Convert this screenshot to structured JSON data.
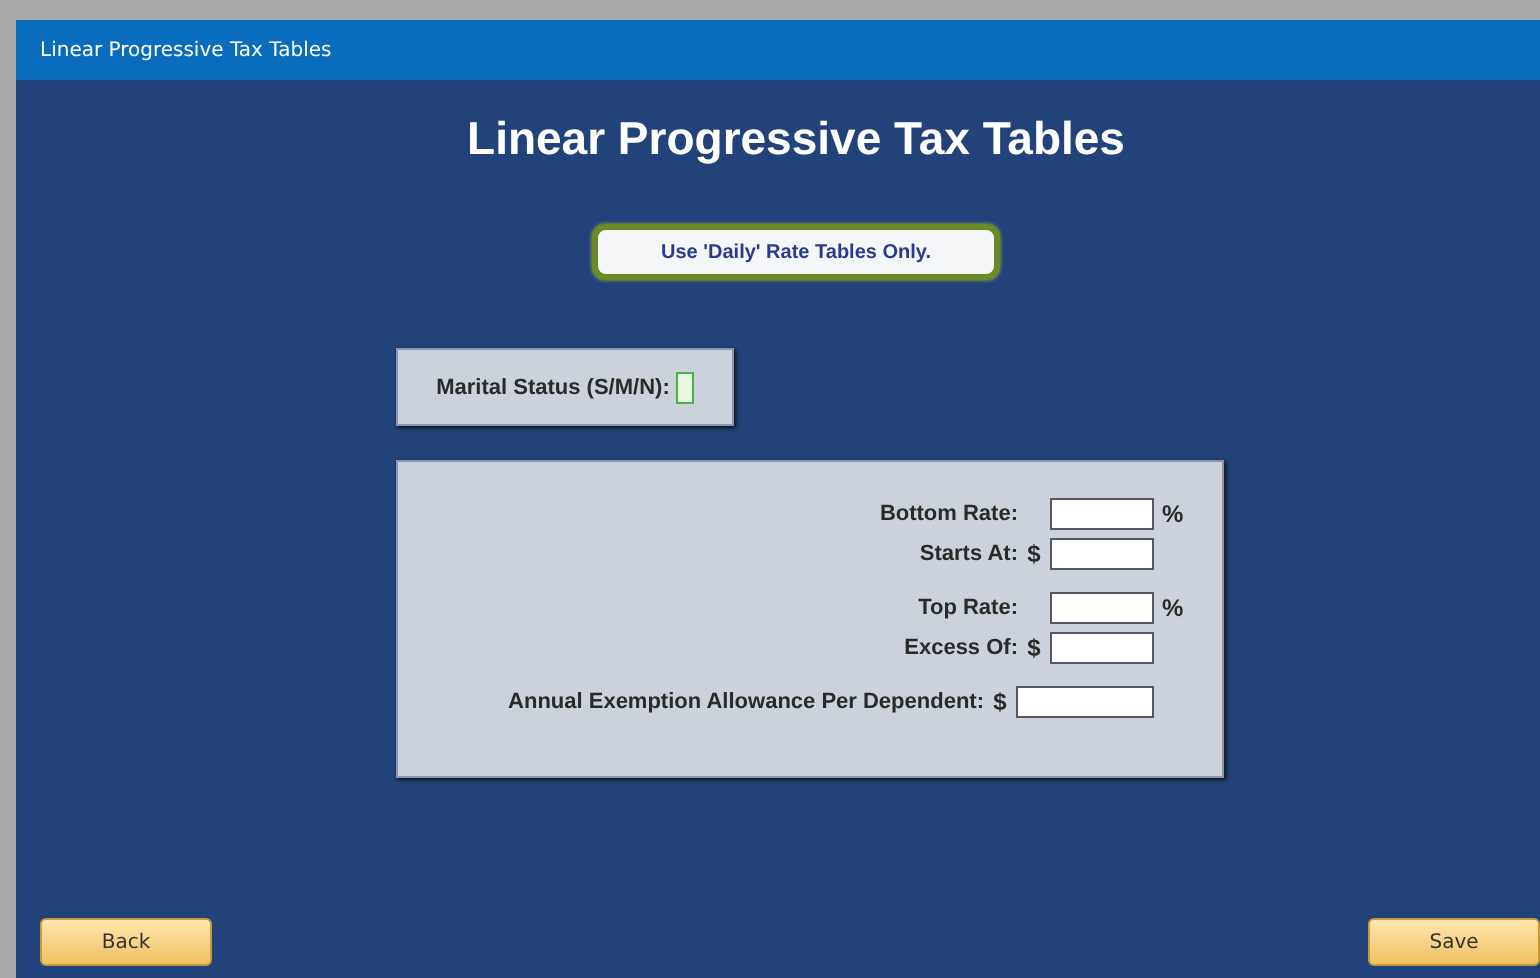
{
  "window": {
    "title": "Linear Progressive Tax Tables"
  },
  "heading": "Linear Progressive Tax Tables",
  "daily_button": "Use 'Daily' Rate Tables Only.",
  "marital": {
    "label": "Marital Status (S/M/N):"
  },
  "groups": [
    {
      "fields": [
        {
          "label": "Bottom Rate:",
          "kind": "rate",
          "unit": "%"
        },
        {
          "label": "Starts At:",
          "kind": "amount",
          "unit": "$"
        }
      ]
    },
    {
      "fields": [
        {
          "label": "Top Rate:",
          "kind": "rate",
          "unit": "%"
        },
        {
          "label": "Excess Of:",
          "kind": "amount",
          "unit": "$"
        }
      ]
    },
    {
      "fields": [
        {
          "label": "Annual Exemption Allowance Per Dependent:",
          "kind": "wide_amount",
          "unit": "$"
        }
      ]
    }
  ],
  "buttons": [
    "Back",
    "Save"
  ]
}
